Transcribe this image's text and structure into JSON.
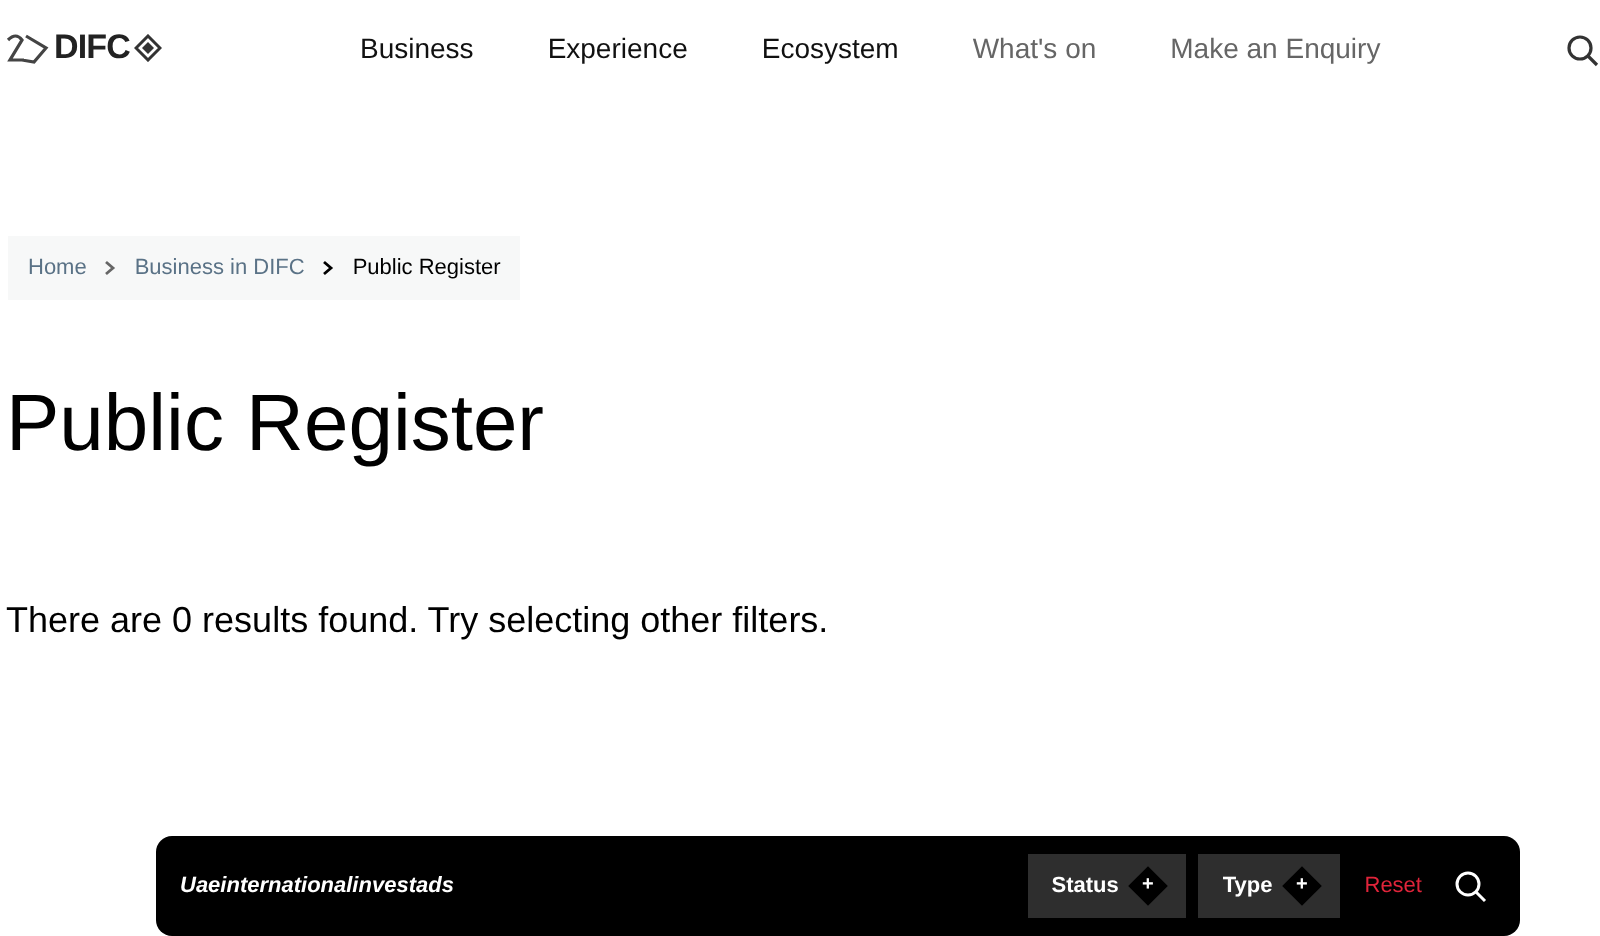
{
  "header": {
    "logo": {
      "text": "DIFC"
    },
    "nav": [
      {
        "label": "Business",
        "dimmed": false
      },
      {
        "label": "Experience",
        "dimmed": false
      },
      {
        "label": "Ecosystem",
        "dimmed": false
      },
      {
        "label": "What's on",
        "dimmed": true
      },
      {
        "label": "Make an Enquiry",
        "dimmed": true
      }
    ]
  },
  "breadcrumb": [
    {
      "label": "Home",
      "current": false
    },
    {
      "label": "Business in DIFC",
      "current": false
    },
    {
      "label": "Public Register",
      "current": true
    }
  ],
  "title": "Public Register",
  "message": "There are 0 results found. Try selecting other filters.",
  "filter_bar": {
    "search": {
      "value": "Uaeinternationalinvestads"
    },
    "filters": [
      {
        "label": "Status",
        "icon": "+"
      },
      {
        "label": "Type",
        "icon": "+"
      }
    ],
    "reset": "Reset"
  }
}
